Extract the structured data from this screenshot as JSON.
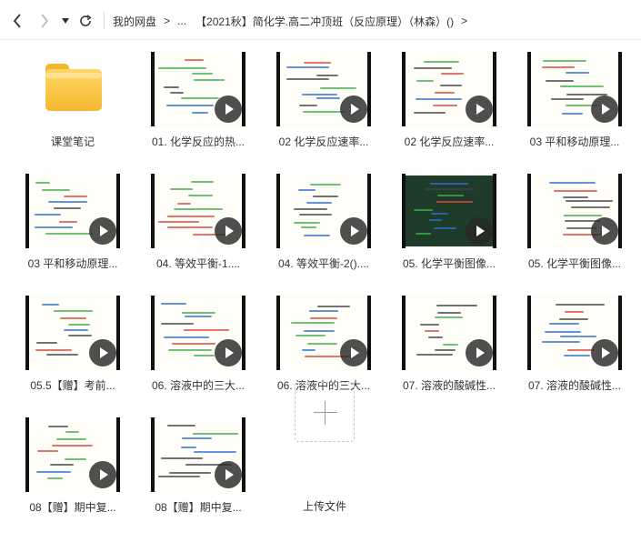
{
  "toolbar": {
    "back_icon": "chevron-left-icon",
    "forward_icon": "chevron-right-icon",
    "dropdown_icon": "caret-down-icon",
    "refresh_icon": "refresh-icon"
  },
  "breadcrumb": {
    "root": "我的网盘",
    "ellipsis": "...",
    "current": "【2021秋】简化学.高二冲顶班（反应原理）（林森）()",
    "separator": ">"
  },
  "folder": {
    "label": "课堂笔记"
  },
  "files": [
    {
      "label": "01. 化学反应的热..."
    },
    {
      "label": "02 化学反应速率..."
    },
    {
      "label": "02 化学反应速率..."
    },
    {
      "label": "03 平和移动原理..."
    },
    {
      "label": "03 平和移动原理..."
    },
    {
      "label": "04. 等效平衡-1...."
    },
    {
      "label": "04. 等效平衡-2()...."
    },
    {
      "label": "05. 化学平衡图像..."
    },
    {
      "label": "05. 化学平衡图像..."
    },
    {
      "label": "05.5【赠】考前..."
    },
    {
      "label": "06. 溶液中的三大..."
    },
    {
      "label": "06. 溶液中的三大..."
    },
    {
      "label": "07. 溶液的酸碱性..."
    },
    {
      "label": "07. 溶液的酸碱性..."
    },
    {
      "label": "08【赠】期中复..."
    },
    {
      "label": "08【赠】期中复..."
    }
  ],
  "upload": {
    "label": "上传文件"
  },
  "colors": {
    "folder": "#f5b731",
    "play": "#282828",
    "ink_blue": "#2f6fd6",
    "ink_green": "#3fae4a",
    "ink_red": "#d9483b"
  }
}
